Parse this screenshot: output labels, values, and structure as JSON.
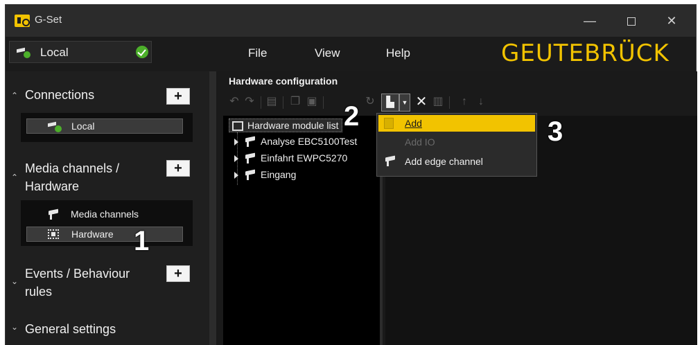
{
  "window": {
    "title": "G-Set"
  },
  "location": {
    "label": "Local",
    "status": "connected"
  },
  "menu": {
    "file": "File",
    "view": "View",
    "help": "Help"
  },
  "brand": "GEUTEBRÜCK",
  "sidebar": {
    "connections": {
      "label": "Connections",
      "add": "+",
      "items": [
        {
          "label": "Local",
          "icon": "local-camera-icon"
        }
      ]
    },
    "media": {
      "label_line1": "Media channels /",
      "label_line2": "Hardware",
      "add": "+",
      "items": [
        {
          "label": "Media channels",
          "icon": "camera-icon"
        },
        {
          "label": "Hardware",
          "icon": "chip-icon",
          "selected": true
        }
      ]
    },
    "events": {
      "label_line1": "Events / Behaviour",
      "label_line2": "rules",
      "add": "+"
    },
    "general": {
      "label": "General settings"
    }
  },
  "main": {
    "title": "Hardware configuration",
    "tree": {
      "root": "Hardware module list",
      "items": [
        {
          "label": "Analyse EBC5100Test"
        },
        {
          "label": "Einfahrt EWPC5270"
        },
        {
          "label": "Eingang"
        }
      ]
    },
    "dropdown": {
      "items": [
        {
          "label": "Add",
          "state": "highlighted"
        },
        {
          "label": "Add IO",
          "state": "disabled"
        },
        {
          "label": "Add edge channel",
          "state": "enabled"
        }
      ]
    }
  },
  "callouts": {
    "one": "1",
    "two": "2",
    "three": "3"
  },
  "colors": {
    "accent": "#f2c300",
    "background": "#1f1f1f",
    "ok": "#4caf2a"
  }
}
